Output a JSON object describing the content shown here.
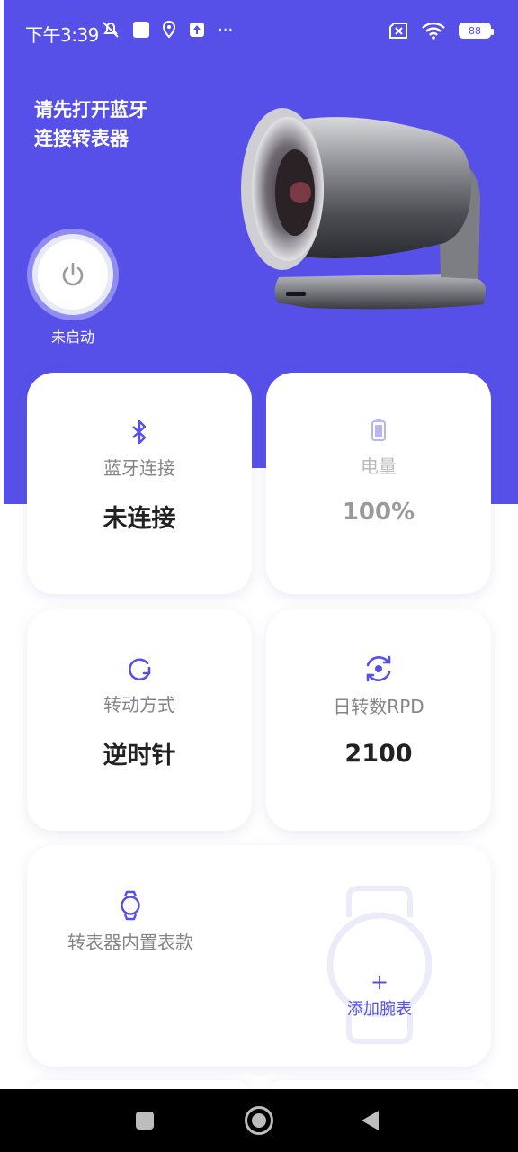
{
  "status_bar": {
    "time": "下午3:39",
    "more": "···",
    "battery": "88"
  },
  "header": {
    "title": "请先打开蓝牙\n连接转表器",
    "power_state": "未启动"
  },
  "cards": {
    "bluetooth": {
      "label": "蓝牙连接",
      "value": "未连接"
    },
    "battery": {
      "label": "电量",
      "value": "100%"
    },
    "rotation_mode": {
      "label": "转动方式",
      "value": "逆时针"
    },
    "rpd": {
      "label": "日转数RPD",
      "value": "2100"
    },
    "watches": {
      "label": "转表器内置表款",
      "add_plus": "+",
      "add_label": "添加腕表"
    }
  },
  "colors": {
    "accent": "#5650e8",
    "muted_label": "#858585",
    "value_text": "#222222"
  },
  "icons": {
    "bluetooth": "bluetooth-icon",
    "battery": "battery-icon",
    "rotation": "rotation-icon",
    "rpd": "rotate-eye-icon",
    "watch": "watch-icon",
    "power": "power-icon"
  }
}
